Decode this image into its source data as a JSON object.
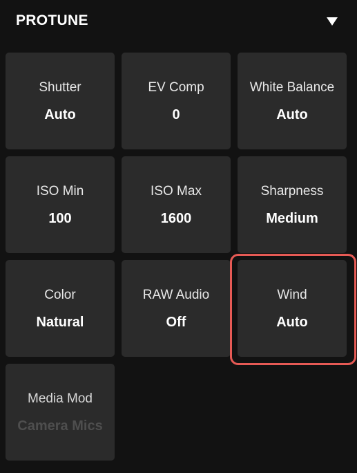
{
  "header": {
    "title": "PROTUNE"
  },
  "tiles": [
    {
      "label": "Shutter",
      "value": "Auto"
    },
    {
      "label": "EV Comp",
      "value": "0"
    },
    {
      "label": "White Balance",
      "value": "Auto"
    },
    {
      "label": "ISO Min",
      "value": "100"
    },
    {
      "label": "ISO Max",
      "value": "1600"
    },
    {
      "label": "Sharpness",
      "value": "Medium"
    },
    {
      "label": "Color",
      "value": "Natural"
    },
    {
      "label": "RAW Audio",
      "value": "Off"
    },
    {
      "label": "Wind",
      "value": "Auto",
      "highlighted": true
    },
    {
      "label": "Media Mod",
      "value": "Camera Mics",
      "disabled": true
    }
  ],
  "colors": {
    "background": "#121212",
    "tile": "#2b2b2b",
    "highlight": "#e65a55",
    "disabled_value": "#4e4e4e"
  }
}
